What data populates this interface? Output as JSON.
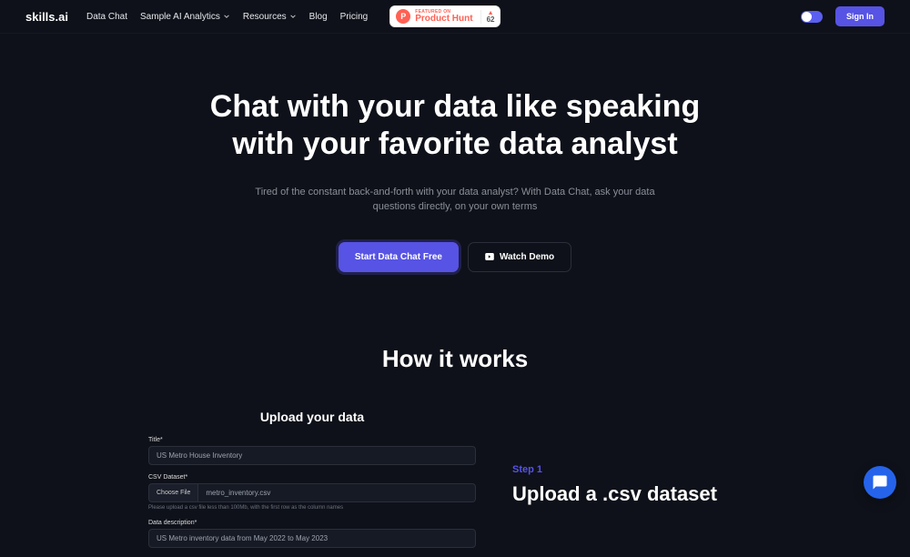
{
  "header": {
    "logo": "skills.ai",
    "nav": {
      "data_chat": "Data Chat",
      "sample": "Sample AI Analytics",
      "resources": "Resources",
      "blog": "Blog",
      "pricing": "Pricing"
    },
    "product_hunt": {
      "featured": "FEATURED ON",
      "name": "Product Hunt",
      "votes": "62"
    },
    "signin": "Sign In"
  },
  "hero": {
    "title": "Chat with your data like speaking with your favorite data analyst",
    "subtitle": "Tired of the constant back-and-forth with your data analyst? With Data Chat, ask your data questions directly, on your own terms",
    "cta_primary": "Start Data Chat Free",
    "cta_secondary": "Watch Demo"
  },
  "how": {
    "title": "How it works",
    "upload": {
      "heading": "Upload your data",
      "title_label": "Title*",
      "title_value": "US Metro House Inventory",
      "csv_label": "CSV Dataset*",
      "choose_file": "Choose File",
      "file_name": "metro_inventory.csv",
      "hint": "Please upload a csv file less than 100Mb, with the first row as the column names",
      "desc_label": "Data description*",
      "desc_value": "US Metro inventory data from May 2022 to May 2023"
    },
    "step": {
      "label": "Step 1",
      "title": "Upload a .csv dataset"
    }
  }
}
